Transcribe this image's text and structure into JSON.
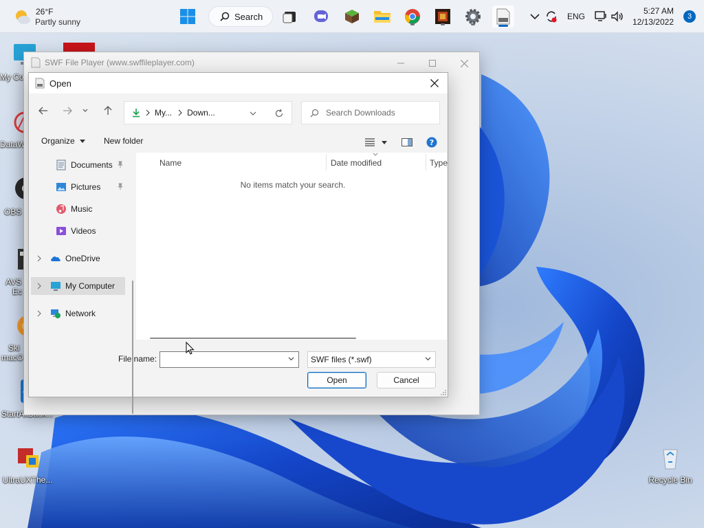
{
  "taskbar": {
    "weather": {
      "temp": "26°F",
      "condition": "Partly sunny",
      "icon": "partly-sunny-icon"
    },
    "search_label": "Search",
    "apps": [
      "windows-start-icon",
      "search-icon",
      "task-view-icon",
      "teams-chat-icon",
      "minecraft-icon",
      "file-explorer-icon",
      "chrome-icon",
      "app-icon",
      "settings-icon",
      "swf-player-icon"
    ],
    "tray": {
      "language": "ENG",
      "time": "5:27 AM",
      "date": "12/13/2022",
      "notification_count": "3"
    }
  },
  "desktop": {
    "icons": [
      {
        "label": "My Co",
        "icon": "my-computer-icon"
      },
      {
        "label": "DataW",
        "icon": "datawrapper-icon"
      },
      {
        "label": "OBS",
        "icon": "obs-icon"
      },
      {
        "label": "AVS",
        "label2": "Ec",
        "icon": "avs-editor-icon"
      },
      {
        "label": "Ski",
        "label2": "macO",
        "icon": "skin-pack-icon"
      },
      {
        "label": "StartAllBack...",
        "icon": "startallback-icon"
      },
      {
        "label": "UltraUXThe...",
        "icon": "ultrauxtheme-icon"
      },
      {
        "label": "Recycle Bin",
        "icon": "recycle-bin-icon"
      }
    ]
  },
  "swf_window": {
    "title": "SWF File Player (www.swffileplayer.com)"
  },
  "dialog": {
    "title": "Open",
    "breadcrumb": [
      "My...",
      "Down..."
    ],
    "search_placeholder": "Search Downloads",
    "organize_label": "Organize",
    "new_folder_label": "New folder",
    "nav_items": [
      {
        "label": "Documents",
        "icon": "documents-icon",
        "pinned": true
      },
      {
        "label": "Pictures",
        "icon": "pictures-icon",
        "pinned": true
      },
      {
        "label": "Music",
        "icon": "music-icon"
      },
      {
        "label": "Videos",
        "icon": "videos-icon"
      },
      {
        "label": "OneDrive",
        "icon": "onedrive-icon"
      },
      {
        "label": "My Computer",
        "icon": "computer-icon",
        "selected": true
      },
      {
        "label": "Network",
        "icon": "network-icon"
      }
    ],
    "columns": [
      "Name",
      "Date modified",
      "Type"
    ],
    "empty_message": "No items match your search.",
    "file_name_label": "File name:",
    "file_name_value": "",
    "file_type": "SWF files (*.swf)",
    "open_label": "Open",
    "cancel_label": "Cancel"
  },
  "colors": {
    "accent": "#0067c0",
    "taskbar_bg": "#eef1f6",
    "dialog_bg": "#f3f3f3",
    "wallpaper_blue": "#1f5fe0"
  }
}
